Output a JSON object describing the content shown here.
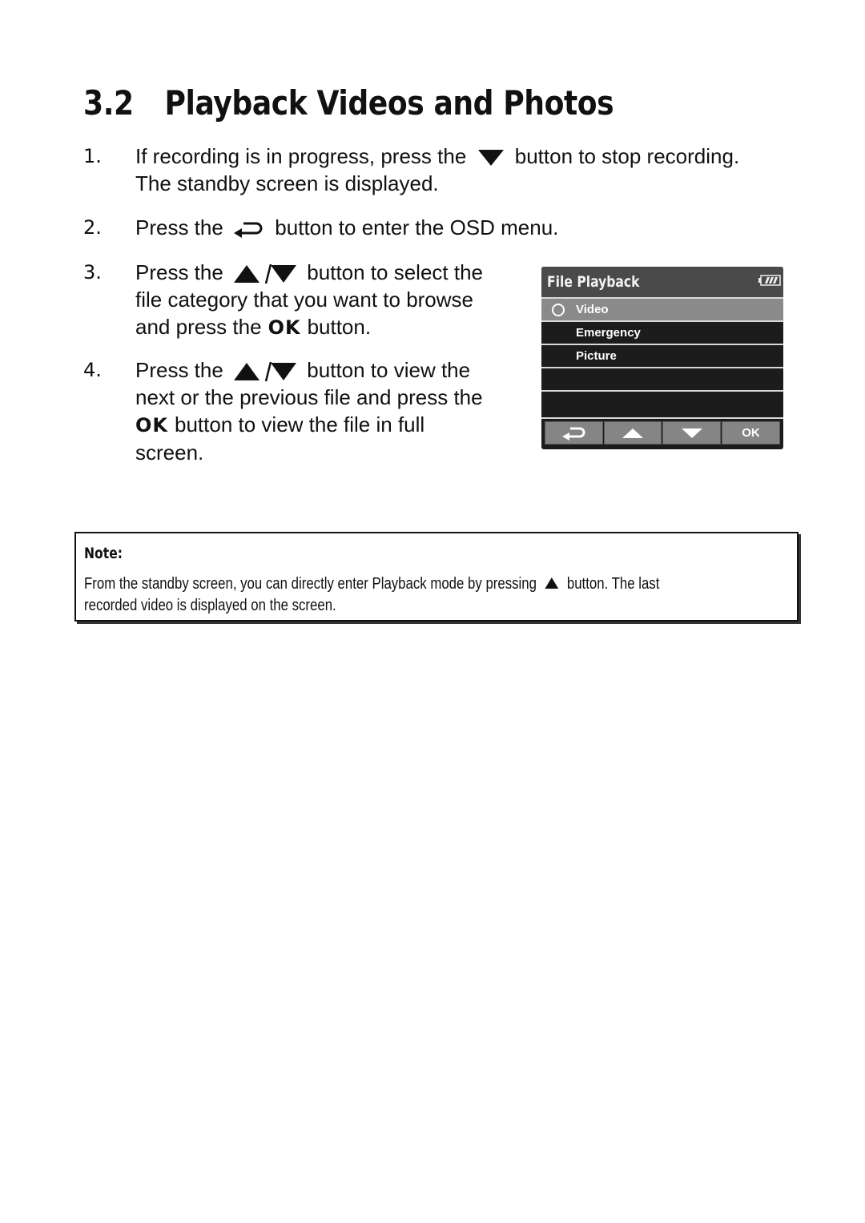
{
  "heading": {
    "number": "3.2",
    "title": "Playback Videos and Photos"
  },
  "steps": [
    {
      "num": "1.",
      "line1_pre": "If recording is in progress, press the",
      "line1_icon": "down-triangle-icon",
      "line1_post": "button to stop recording.",
      "line2": "The standby screen is displayed."
    },
    {
      "num": "2.",
      "pre": "Press the",
      "icon": "return-icon",
      "post": "button to enter the OSD menu."
    },
    {
      "num": "3.",
      "line1_pre": "Press the",
      "line1_icon": "up-down-triangle-icon",
      "line1_post": "button to select the",
      "line2": "file category that you want to browse",
      "line3_pre": "and press the",
      "line3_ok": "OK",
      "line3_post": "button."
    },
    {
      "num": "4.",
      "line1_pre": "Press the",
      "line1_icon": "up-down-triangle-icon",
      "line1_post": "button to view the",
      "line2": "next or the previous file and press the",
      "line3_ok": "OK",
      "line3_post": "button to view the file in full",
      "line4": "screen."
    }
  ],
  "device_screen": {
    "title": "File Playback",
    "battery_icon": "battery-full-icon",
    "items": [
      {
        "label": "Video",
        "selected": true
      },
      {
        "label": "Emergency",
        "selected": false
      },
      {
        "label": "Picture",
        "selected": false
      },
      {
        "label": "",
        "selected": false
      },
      {
        "label": "",
        "selected": false
      }
    ],
    "buttons": [
      {
        "icon": "return-icon",
        "label": ""
      },
      {
        "icon": "up-triangle-icon",
        "label": ""
      },
      {
        "icon": "down-triangle-icon",
        "label": ""
      },
      {
        "icon": "",
        "label": "OK"
      }
    ]
  },
  "note": {
    "title": "Note:",
    "text_pre": "From the standby screen, you can directly enter Playback mode by pressing",
    "text_icon": "up-triangle-icon",
    "text_post": "button. The last",
    "text_line2": "recorded video is displayed on the screen."
  }
}
